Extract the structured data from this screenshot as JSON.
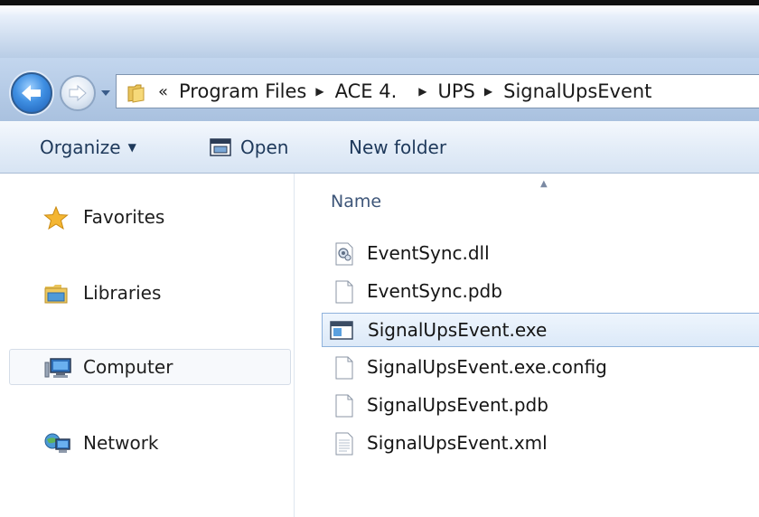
{
  "address": {
    "overflow_label": "«",
    "segments": [
      "Program Files",
      "ACE 4.",
      "UPS",
      "SignalUpsEvent"
    ]
  },
  "toolbar": {
    "organize_label": "Organize",
    "organize_caret": "▼",
    "open_label": "Open",
    "new_folder_label": "New folder"
  },
  "nav": {
    "items": [
      {
        "label": "Favorites",
        "icon": "star-icon"
      },
      {
        "label": "Libraries",
        "icon": "libraries-icon"
      },
      {
        "label": "Computer",
        "icon": "computer-icon"
      },
      {
        "label": "Network",
        "icon": "network-icon"
      }
    ]
  },
  "files": {
    "column_name": "Name",
    "sort_indicator": "▲",
    "items": [
      {
        "name": "EventSync.dll",
        "icon": "dll-file-icon"
      },
      {
        "name": "EventSync.pdb",
        "icon": "blank-file-icon"
      },
      {
        "name": "SignalUpsEvent.exe",
        "icon": "exe-file-icon",
        "selected": true
      },
      {
        "name": "SignalUpsEvent.exe.config",
        "icon": "blank-file-icon"
      },
      {
        "name": "SignalUpsEvent.pdb",
        "icon": "blank-file-icon"
      },
      {
        "name": "SignalUpsEvent.xml",
        "icon": "text-file-icon"
      }
    ]
  },
  "colors": {
    "accent": "#1e395b",
    "selection_border": "#8fb2dc",
    "toolbar_bg": "#e4edf8"
  }
}
